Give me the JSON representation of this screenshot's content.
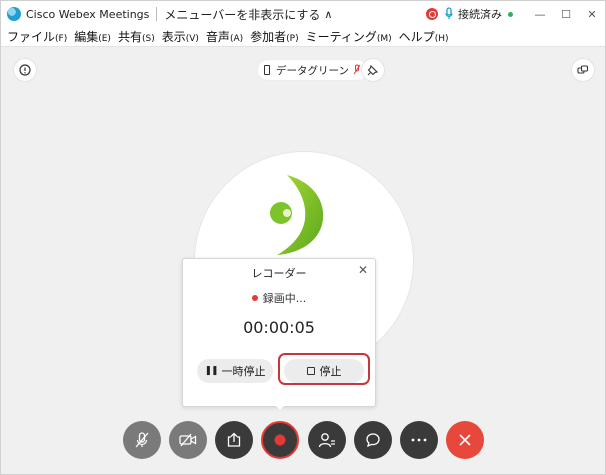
{
  "titlebar": {
    "app_title": "Cisco Webex Meetings",
    "hide_menu_label": "メニューバーを非表示にする",
    "connection_status": "接続済み",
    "status_color": "#2eb25a",
    "record_color": "#e53935"
  },
  "menubar": {
    "items": [
      {
        "label": "ファイル",
        "key": "(F)"
      },
      {
        "label": "編集",
        "key": "(E)"
      },
      {
        "label": "共有",
        "key": "(S)"
      },
      {
        "label": "表示",
        "key": "(V)"
      },
      {
        "label": "音声",
        "key": "(A)"
      },
      {
        "label": "参加者",
        "key": "(P)"
      },
      {
        "label": "ミーティング",
        "key": "(M)"
      },
      {
        "label": "ヘルプ",
        "key": "(H)"
      }
    ]
  },
  "top_controls": {
    "network_name": "データグリーン"
  },
  "recorder": {
    "title": "レコーダー",
    "status_text": "録画中...",
    "timer": "00:00:05",
    "pause_label": "一時停止",
    "stop_label": "停止"
  },
  "toolbar": {
    "buttons": [
      {
        "icon": "mic-muted-icon"
      },
      {
        "icon": "video-off-icon"
      },
      {
        "icon": "share-icon"
      },
      {
        "icon": "record-icon"
      },
      {
        "icon": "participants-icon"
      },
      {
        "icon": "chat-icon"
      },
      {
        "icon": "more-icon"
      },
      {
        "icon": "end-meeting-icon"
      }
    ],
    "end_color": "#e8473b"
  }
}
